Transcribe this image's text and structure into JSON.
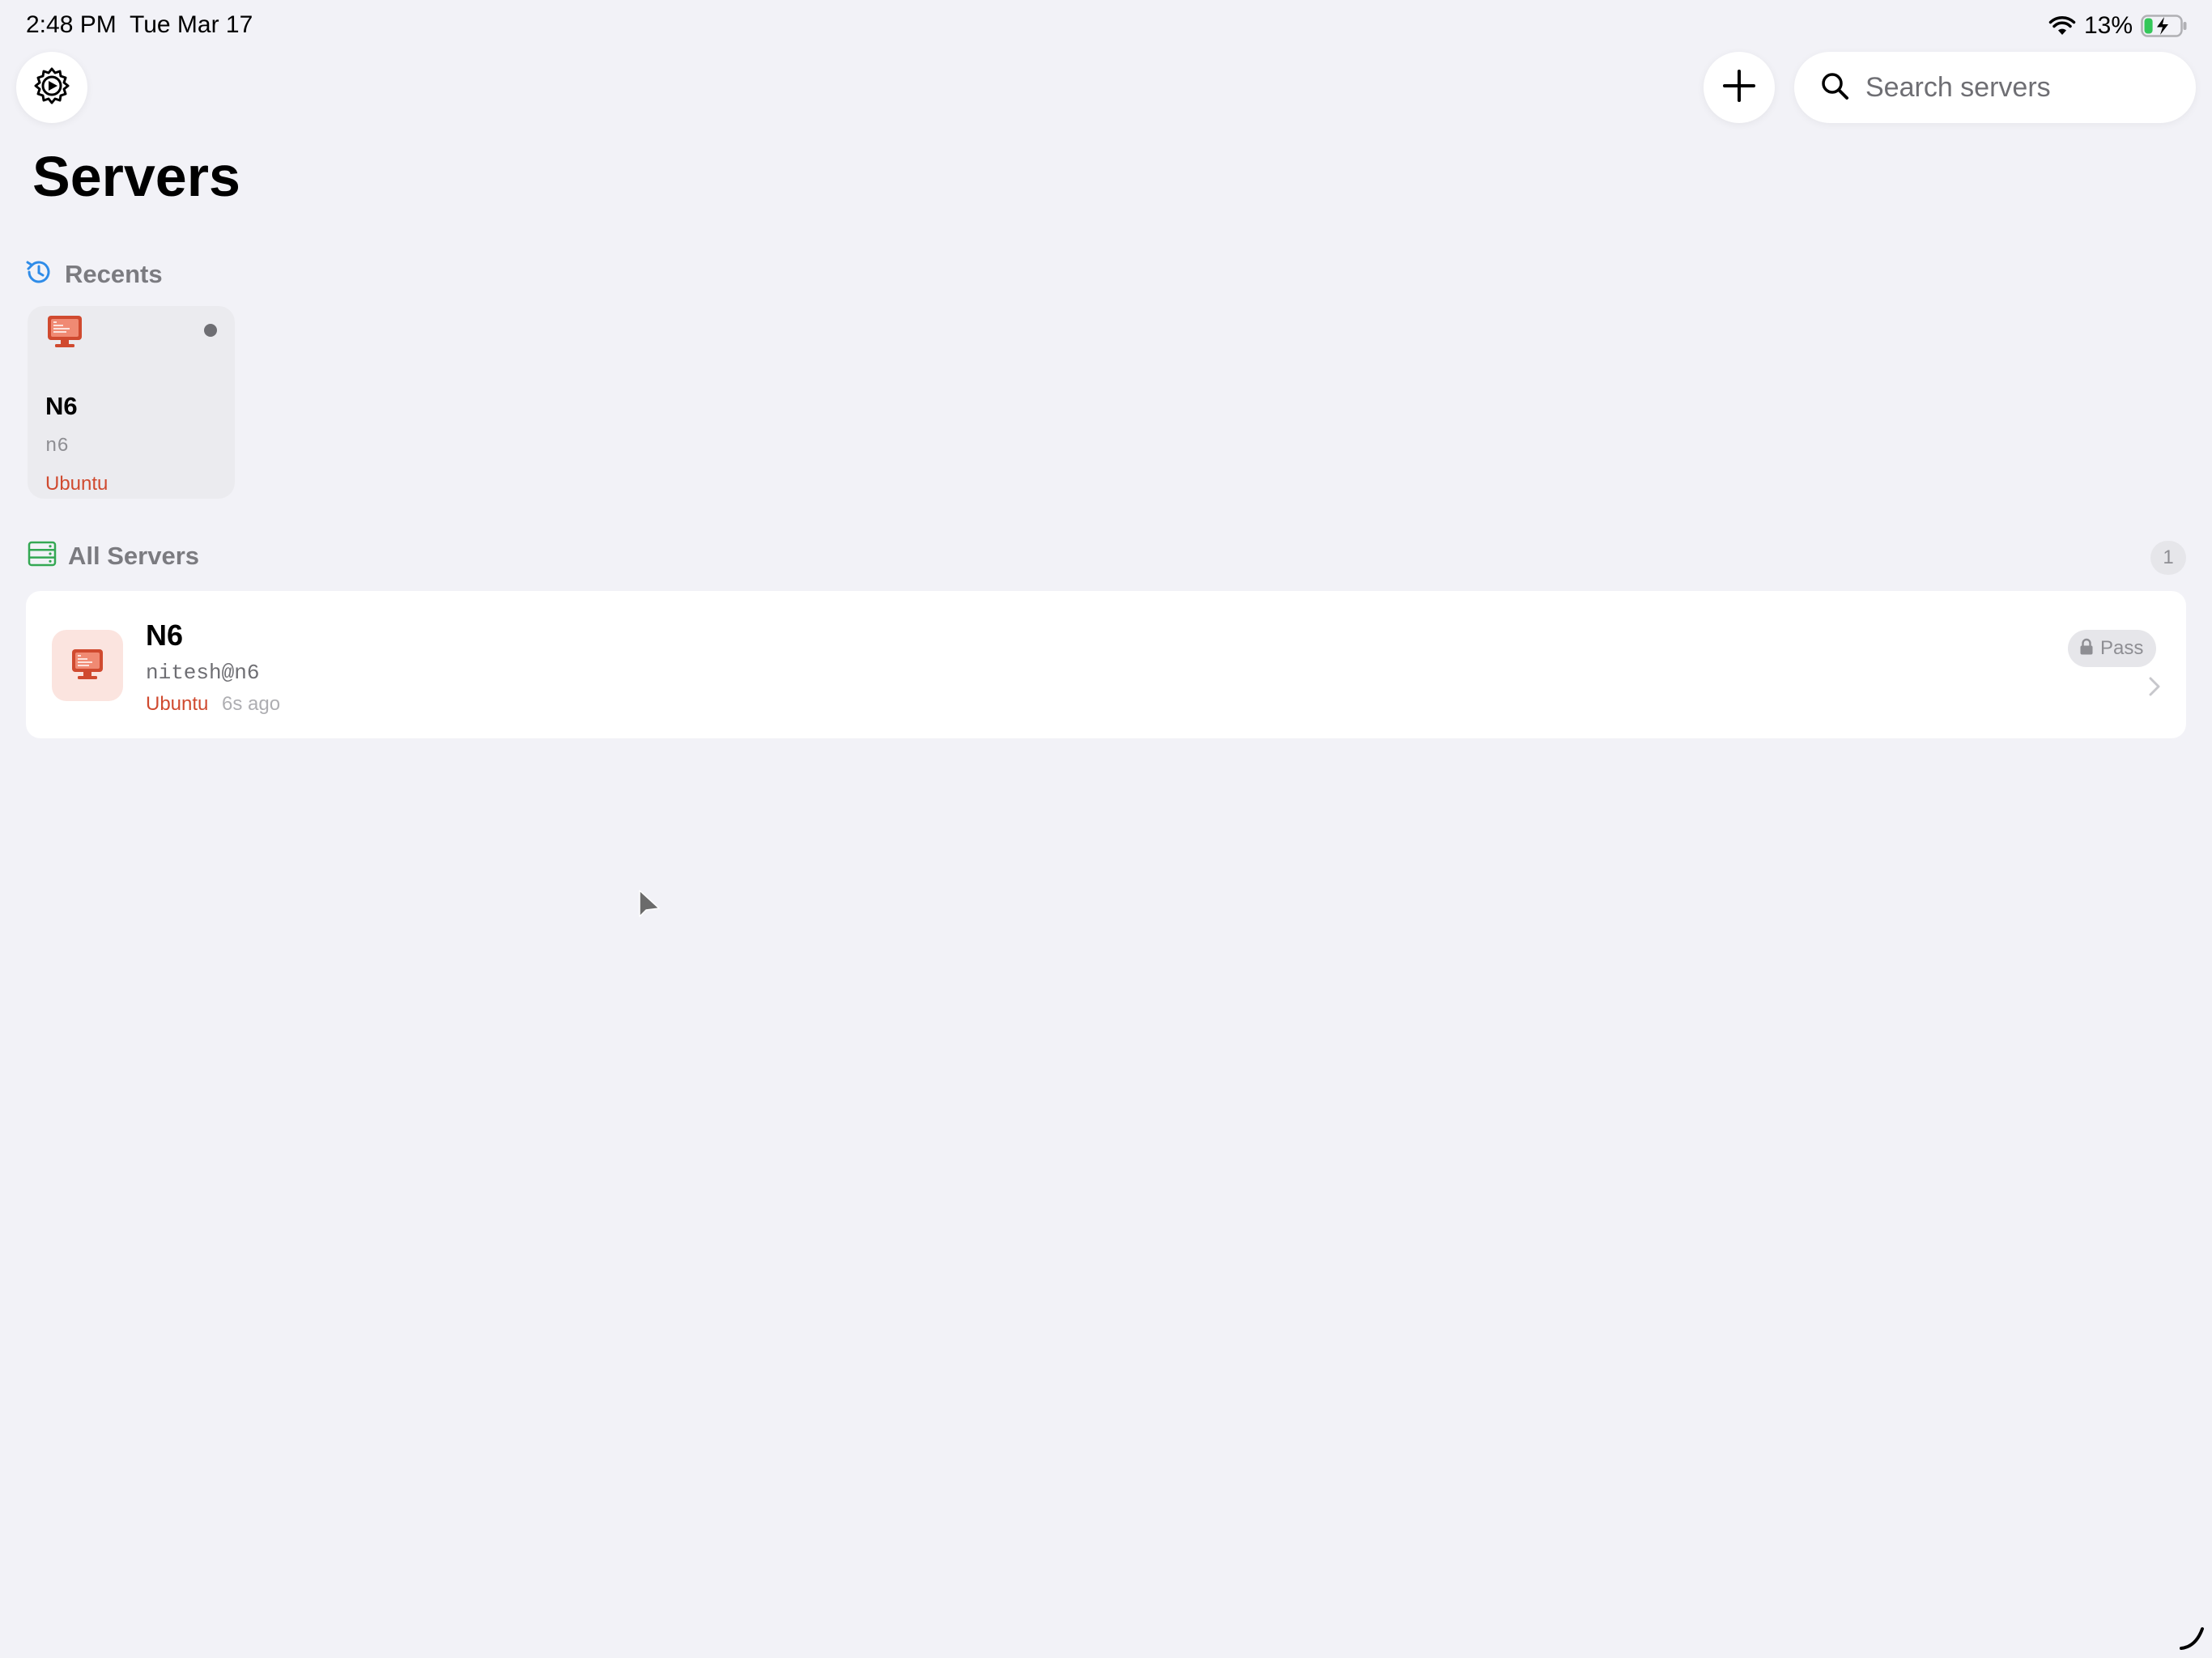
{
  "status_bar": {
    "time": "2:48 PM",
    "date": "Tue Mar 17",
    "battery_percent": "13%",
    "battery_level": 0.13,
    "charging": true,
    "icons": [
      "wifi-icon",
      "battery-charging-icon"
    ]
  },
  "toolbar": {
    "settings_icon": "gear-icon",
    "add_icon": "plus-icon",
    "search": {
      "placeholder": "Search servers",
      "value": "",
      "icon": "search-icon"
    }
  },
  "page": {
    "title": "Servers"
  },
  "recents": {
    "label": "Recents",
    "icon": "clock-history-icon",
    "items": [
      {
        "name": "N6",
        "host": "n6",
        "os": "Ubuntu",
        "icon": "monitor-icon",
        "status_icon": "status-dot"
      }
    ]
  },
  "all_servers": {
    "label": "All Servers",
    "icon": "server-rack-icon",
    "count": "1",
    "items": [
      {
        "name": "N6",
        "host": "nitesh@n6",
        "os": "Ubuntu",
        "last_connected": "6s ago",
        "auth": "Pass",
        "auth_icon": "lock-icon",
        "icon": "monitor-icon",
        "chevron_icon": "chevron-right-icon"
      }
    ]
  },
  "colors": {
    "background": "#f2f2f7",
    "accent_red": "#d04a2f",
    "recents_icon": "#2f8ce8",
    "servers_icon": "#34a853",
    "secondary_text": "#8e8e93"
  }
}
